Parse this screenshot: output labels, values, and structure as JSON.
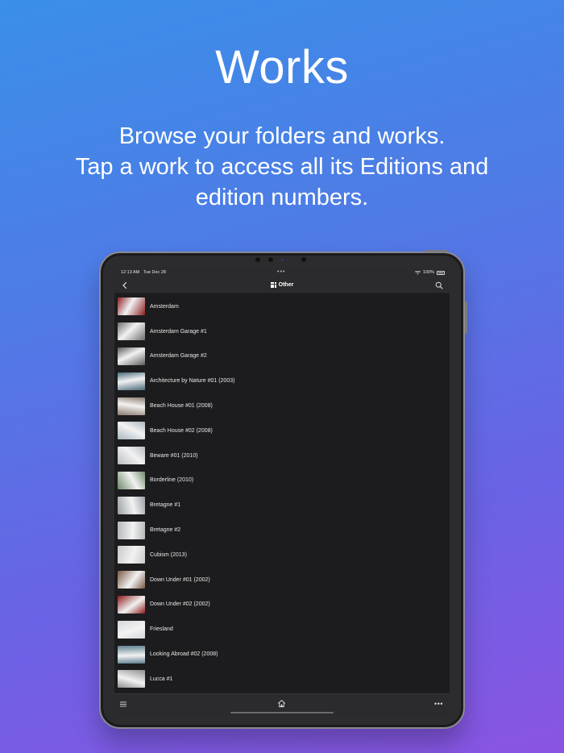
{
  "hero": {
    "title": "Works",
    "subtitle_lines": [
      "Browse your folders and works.",
      "Tap a work to access all its Editions and",
      "edition numbers."
    ]
  },
  "status_bar": {
    "time": "12:13 AM",
    "date": "Tue Dec 28",
    "battery": "100%"
  },
  "nav": {
    "title": "Other",
    "back_icon": "chevron-left-icon",
    "search_icon": "search-icon",
    "folder_icon": "grid-icon"
  },
  "works": [
    {
      "label": "Amsterdam",
      "thumb": "#8a1e22"
    },
    {
      "label": "Amsterdam Garage #1",
      "thumb": "#6e6e6e"
    },
    {
      "label": "Amsterdam Garage #2",
      "thumb": "#5a5a5a"
    },
    {
      "label": "Architecture by Nature #01 (2003)",
      "thumb": "#4a6a7a"
    },
    {
      "label": "Beach House #01 (2008)",
      "thumb": "#8a7a6e"
    },
    {
      "label": "Beach House #02 (2008)",
      "thumb": "#a9b6c0"
    },
    {
      "label": "Beware #01 (2010)",
      "thumb": "#b8bcc0"
    },
    {
      "label": "Borderline (2010)",
      "thumb": "#6f8a6a"
    },
    {
      "label": "Bretagne #1",
      "thumb": "#9aa0a6"
    },
    {
      "label": "Bretagne #2",
      "thumb": "#b5b8bb"
    },
    {
      "label": "Cubism (2013)",
      "thumb": "#c9c9c9"
    },
    {
      "label": "Down Under #01 (2002)",
      "thumb": "#7a5a44"
    },
    {
      "label": "Down Under #02 (2002)",
      "thumb": "#8c1a1a"
    },
    {
      "label": "Friesland",
      "thumb": "#d4d8dc"
    },
    {
      "label": "Looking Abroad #02 (2008)",
      "thumb": "#5e7f90"
    },
    {
      "label": "Lucca #1",
      "thumb": "#8e8e8e"
    }
  ],
  "toolbar": {
    "menu_icon": "menu-icon",
    "home_icon": "home-icon",
    "more_icon": "more-icon"
  }
}
